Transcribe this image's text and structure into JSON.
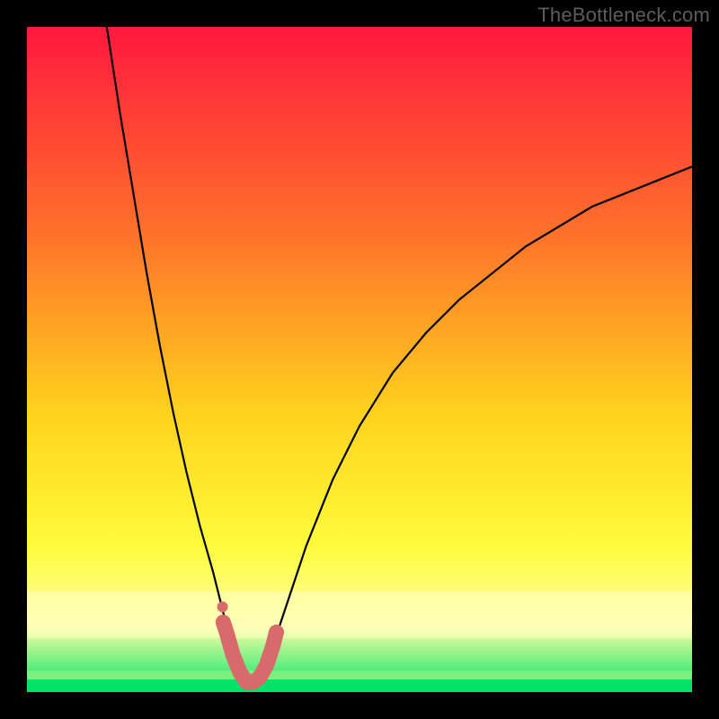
{
  "watermark": "TheBottleneck.com",
  "colors": {
    "frame": "#000000",
    "gradient_top": "#ff193f",
    "gradient_mid1": "#ff6e2b",
    "gradient_mid2": "#ffd21e",
    "gradient_mid3": "#fffb3c",
    "gradient_band": "#ffffa5",
    "gradient_bottom": "#00e36a",
    "curve": "#000000",
    "marker_fill": "#d96a6c",
    "marker_stroke": "#d96a6c"
  },
  "chart_data": {
    "type": "line",
    "title": "",
    "xlabel": "",
    "ylabel": "",
    "xlim": [
      0,
      100
    ],
    "ylim": [
      0,
      100
    ],
    "x_min_point": 33,
    "series": [
      {
        "name": "bottleneck-curve",
        "x": [
          12,
          14,
          16,
          18,
          20,
          22,
          24,
          26,
          28,
          29,
          30,
          31,
          32,
          33,
          34,
          35,
          36,
          37,
          38,
          40,
          42,
          44,
          46,
          48,
          50,
          55,
          60,
          65,
          70,
          75,
          80,
          85,
          90,
          95,
          100
        ],
        "y": [
          100,
          87,
          75,
          63,
          52,
          42,
          33,
          25,
          18,
          14,
          10,
          6,
          3,
          1,
          1,
          2,
          4,
          7,
          10,
          16,
          22,
          27,
          32,
          36,
          40,
          48,
          54,
          59,
          63,
          67,
          70,
          73,
          75,
          77,
          79
        ]
      }
    ],
    "markers": {
      "name": "highlighted-segment",
      "x": [
        29.5,
        30,
        31,
        32,
        33,
        34,
        35,
        36,
        37,
        37.5
      ],
      "y": [
        10.5,
        9,
        5.5,
        3,
        1.5,
        1.5,
        2.2,
        4,
        7,
        9
      ]
    },
    "extra_marker": {
      "x": 29.4,
      "y": 12.8
    }
  }
}
